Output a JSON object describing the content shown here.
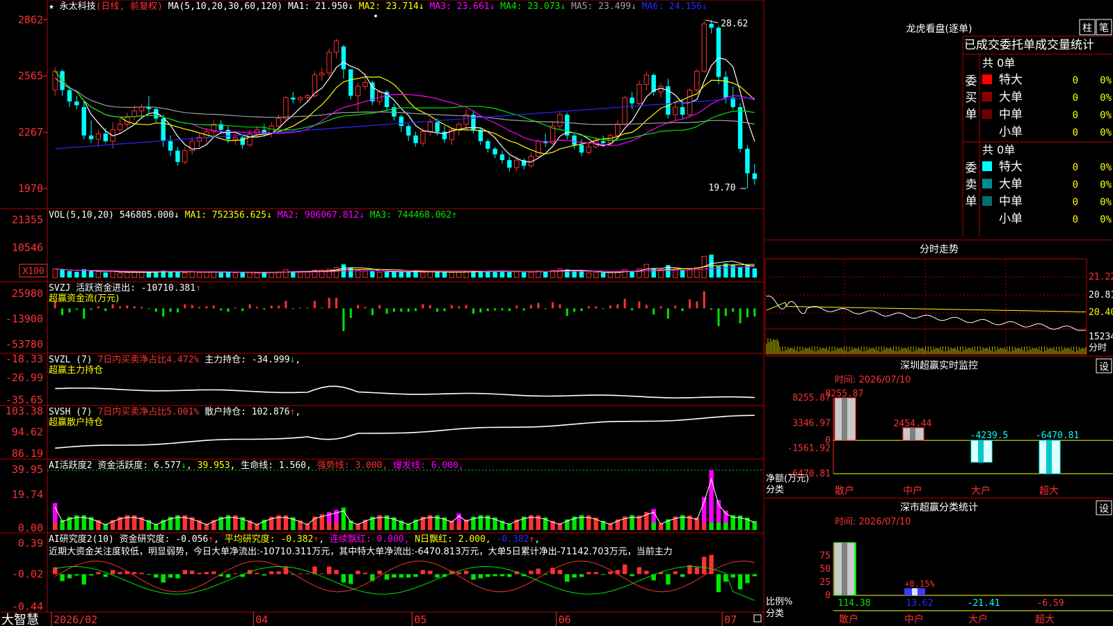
{
  "app": {
    "brand": "大智慧",
    "settings_label": "设",
    "buttons": {
      "zhu": "柱",
      "bi": "笔"
    }
  },
  "colors": {
    "red": "#ff3232",
    "cyan": "#00ffff",
    "white": "#ffffff",
    "yellow": "#ffff00",
    "magenta": "#ff00ff",
    "green": "#00e600",
    "blue": "#2828ff",
    "gray": "#a0a0a0",
    "frame": "#b40000"
  },
  "main_chart": {
    "star": "★",
    "stock_name": "永太科技",
    "period": "(日线, 前复权)",
    "ma_prefix": "MA(5,10,20,30,60,120)",
    "ma": [
      {
        "label": "MA1:",
        "value": "21.950",
        "arrow": "↓",
        "color": "#ffffff"
      },
      {
        "label": "MA2:",
        "value": "23.714",
        "arrow": "↓",
        "color": "#ffff00"
      },
      {
        "label": "MA3:",
        "value": "23.661",
        "arrow": "↓",
        "color": "#ff00ff"
      },
      {
        "label": "MA4:",
        "value": "23.073",
        "arrow": "↓",
        "color": "#00e600"
      },
      {
        "label": "MA5:",
        "value": "23.499",
        "arrow": "↓",
        "color": "#a0a0a0"
      },
      {
        "label": "MA6:",
        "value": "24.156",
        "arrow": "↓",
        "color": "#2828ff"
      }
    ],
    "y_ticks": [
      "2862",
      "2565",
      "2267",
      "1970"
    ],
    "y_values": [
      28.62,
      25.65,
      22.67,
      19.7
    ],
    "high_label": "28.62",
    "low_label": "19.70",
    "price_range": [
      19.0,
      29.0
    ]
  },
  "x_axis": {
    "labels": [
      "2026/02",
      "04",
      "05",
      "06",
      "07"
    ],
    "label_index": [
      0,
      28,
      50,
      70,
      93
    ]
  },
  "vol_panel": {
    "title": "VOL(5,10,20)",
    "vol": "546805.000",
    "vol_arrow": "↓",
    "ma1": "MA1: 752356.625",
    "ma1_arrow": "↓",
    "ma2": "MA2: 906067.812",
    "ma2_arrow": "↓",
    "ma3": "MA3: 744468.062",
    "ma3_arrow": "↑",
    "y_ticks": [
      "21355",
      "10546"
    ],
    "unit": "X100",
    "max": 22000
  },
  "svzj_panel": {
    "title": "SVZJ",
    "label": "活跃资金进出:",
    "value": "-10710.381",
    "arrow": "↑",
    "subtitle": "超赢资金流(万元)",
    "y_ticks": [
      "25980",
      "-13900",
      "-53780"
    ],
    "range": [
      -53780,
      25980
    ]
  },
  "svzl_panel": {
    "title": "SVZL (7)",
    "ratio_text": "7日内买卖净占比4.472%",
    "holding_label": "主力持仓:",
    "holding_value": "-34.999",
    "arrow": "↓",
    "subtitle": "超赢主力持仓",
    "y_ticks": [
      "-18.33",
      "-26.99",
      "-35.65"
    ],
    "range": [
      -35.65,
      -18.33
    ]
  },
  "svsh_panel": {
    "title": "SVSH (7)",
    "ratio_text": "7日内买卖净占比5.001%",
    "holding_label": "散户持仓:",
    "holding_value": "102.876",
    "arrow": "↑",
    "subtitle": "超赢散户持仓",
    "y_ticks": [
      "103.38",
      "94.62",
      "86.19"
    ],
    "range": [
      86.19,
      103.38
    ]
  },
  "ai_active_panel": {
    "title": "AI活跃度2",
    "label": "资金活跃度:",
    "value1": "6.577",
    "arrow1": "↓",
    "value2": "39.953",
    "life_label": "生命线:",
    "life_value": "1.560",
    "strong_label": "强势线:",
    "strong_value": "3.000",
    "burst_label": "爆发线:",
    "burst_value": "6.000",
    "y_ticks": [
      "39.95",
      "19.74",
      "0.00"
    ],
    "max": 39.95
  },
  "ai_research_panel": {
    "title": "AI研究度2(10)",
    "label": "资金研究度:",
    "value": "-0.056",
    "arrow": "↑",
    "avg_label": "平均研究度:",
    "avg_value": "-0.382",
    "avg_arrow": "↑",
    "red_label": "连续飘红:",
    "red_value": "0.000",
    "n_label": "N日飘红:",
    "n_value": "2.000",
    "last_value": "-0.382",
    "last_arrow": "↑",
    "comment": "近期大资金关注度较低，明显弱势，今日大单净流出:-10710.311万元，其中特大单净流出:-6470.813万元，大单5日累计净出-71142.703万元，当前主力",
    "y_ticks": [
      "0.39",
      "-0.02",
      "-0.44"
    ],
    "range": [
      -0.44,
      0.39
    ]
  },
  "right_top": {
    "title": "龙虎看盘(逐单)",
    "headers": [
      "已成交",
      "委托单",
      "成交量统计"
    ],
    "buy_section": {
      "side_label": [
        "委",
        "买",
        "单"
      ],
      "total": "共 0单",
      "rows": [
        {
          "name": "特大",
          "count": "0",
          "pct": "0%",
          "color": "#ff0000"
        },
        {
          "name": "大单",
          "count": "0",
          "pct": "0%",
          "color": "#8b0000"
        },
        {
          "name": "中单",
          "count": "0",
          "pct": "0%",
          "color": "#6e0000"
        },
        {
          "name": "小单",
          "count": "0",
          "pct": "0%",
          "color": ""
        }
      ]
    },
    "sell_section": {
      "side_label": [
        "委",
        "卖",
        "单"
      ],
      "total": "共 0单",
      "rows": [
        {
          "name": "特大",
          "count": "0",
          "pct": "0%",
          "color": "#00ffff"
        },
        {
          "name": "大单",
          "count": "0",
          "pct": "0%",
          "color": "#008b8b"
        },
        {
          "name": "中单",
          "count": "0",
          "pct": "0%",
          "color": "#006e6e"
        },
        {
          "name": "小单",
          "count": "0",
          "pct": "0%",
          "color": ""
        }
      ]
    }
  },
  "intraday": {
    "title": "分时走势",
    "y_ticks": [
      "21.22",
      "20.81",
      "20.40"
    ],
    "vol_label": "15234",
    "vol_sub": "分时"
  },
  "sz_monitor": {
    "title": "深圳超赢实时监控",
    "time_label": "时间: 2026/07/10",
    "y_ticks": [
      "8255.87",
      "3346.97",
      "0",
      "-1561.92",
      "-6470.81"
    ],
    "range": [
      -6470.81,
      8255.87
    ],
    "unit_label": "净额(万元)",
    "category_label": "分类",
    "bars": [
      {
        "name": "散户",
        "value": 8255.87,
        "label": "8255.87"
      },
      {
        "name": "中户",
        "value": 2454.44,
        "label": "2454.44"
      },
      {
        "name": "大户",
        "value": -4239.5,
        "label": "-4239.5"
      },
      {
        "name": "超大",
        "value": -6470.81,
        "label": "-6470.81"
      }
    ]
  },
  "sz_class": {
    "title": "深市超赢分类统计",
    "time_label": "时间: 2026/07/10",
    "y_ticks": [
      "75",
      "50",
      "25",
      "0"
    ],
    "ratio_label": "比例%",
    "category_label": "分类",
    "bars": [
      {
        "name": "散户",
        "value": 114.38,
        "label": "114.38"
      },
      {
        "name": "中户",
        "value": 13.62,
        "label": "13.62"
      },
      {
        "name": "大户",
        "value": -21.41,
        "label": "-21.41"
      },
      {
        "name": "超大",
        "value": -6.59,
        "label": "-6.59"
      }
    ],
    "mid_label": "+0.15%"
  },
  "chart_data": [
    {
      "type": "candlestick",
      "title": "永太科技 (日线, 前复权)",
      "ylim": [
        19.7,
        28.62
      ],
      "ohlc": [
        [
          24.9,
          26.1,
          24.6,
          25.9
        ],
        [
          25.9,
          26.0,
          24.6,
          24.9
        ],
        [
          24.9,
          25.1,
          24.0,
          24.3
        ],
        [
          24.3,
          24.6,
          23.9,
          24.1
        ],
        [
          24.0,
          24.3,
          22.3,
          22.5
        ],
        [
          22.5,
          23.3,
          22.1,
          22.3
        ],
        [
          22.3,
          22.8,
          21.9,
          22.6
        ],
        [
          22.6,
          22.9,
          22.1,
          22.2
        ],
        [
          22.2,
          23.2,
          21.8,
          22.8
        ],
        [
          22.8,
          23.4,
          22.6,
          23.1
        ],
        [
          23.1,
          23.7,
          22.9,
          23.5
        ],
        [
          23.5,
          24.1,
          23.3,
          23.8
        ],
        [
          23.8,
          24.2,
          23.4,
          24.0
        ],
        [
          24.0,
          24.6,
          23.7,
          23.9
        ],
        [
          23.9,
          24.0,
          23.2,
          23.4
        ],
        [
          23.4,
          23.6,
          21.9,
          22.2
        ],
        [
          22.2,
          22.5,
          21.4,
          21.7
        ],
        [
          21.7,
          21.9,
          20.9,
          21.1
        ],
        [
          21.1,
          21.9,
          21.0,
          21.7
        ],
        [
          21.7,
          22.4,
          21.5,
          22.2
        ],
        [
          22.2,
          22.6,
          21.9,
          22.4
        ],
        [
          22.4,
          22.9,
          22.1,
          22.7
        ],
        [
          22.7,
          23.3,
          22.5,
          23.1
        ],
        [
          23.1,
          23.3,
          22.6,
          22.8
        ],
        [
          22.8,
          23.0,
          22.1,
          22.3
        ],
        [
          22.3,
          22.6,
          22.0,
          22.4
        ],
        [
          22.4,
          22.5,
          21.8,
          22.0
        ],
        [
          22.0,
          22.8,
          21.9,
          22.6
        ],
        [
          22.6,
          23.0,
          22.4,
          22.8
        ],
        [
          22.8,
          23.1,
          22.5,
          22.6
        ],
        [
          22.6,
          23.2,
          22.4,
          23.0
        ],
        [
          23.0,
          23.6,
          22.9,
          23.4
        ],
        [
          23.4,
          24.6,
          23.3,
          24.5
        ],
        [
          24.5,
          24.8,
          24.2,
          24.4
        ],
        [
          24.4,
          24.6,
          24.2,
          24.5
        ],
        [
          24.5,
          24.7,
          24.3,
          24.6
        ],
        [
          24.6,
          25.9,
          24.5,
          25.7
        ],
        [
          25.7,
          26.1,
          25.4,
          25.8
        ],
        [
          25.8,
          27.1,
          25.6,
          26.9
        ],
        [
          26.9,
          27.6,
          26.6,
          27.5
        ],
        [
          27.2,
          27.3,
          25.5,
          26.0
        ],
        [
          26.0,
          25.9,
          24.4,
          24.6
        ],
        [
          24.6,
          25.3,
          23.8,
          25.1
        ],
        [
          25.1,
          25.6,
          24.9,
          25.3
        ],
        [
          25.3,
          25.4,
          24.1,
          24.3
        ],
        [
          24.3,
          24.9,
          24.1,
          24.8
        ],
        [
          24.8,
          24.9,
          23.8,
          24.0
        ],
        [
          24.0,
          24.2,
          23.3,
          23.5
        ],
        [
          23.5,
          23.6,
          22.7,
          23.0
        ],
        [
          23.0,
          23.1,
          22.2,
          22.5
        ],
        [
          22.5,
          22.7,
          21.9,
          22.1
        ],
        [
          22.1,
          22.9,
          21.9,
          22.7
        ],
        [
          22.7,
          23.4,
          22.5,
          23.2
        ],
        [
          23.2,
          23.4,
          22.5,
          22.7
        ],
        [
          22.7,
          23.0,
          22.1,
          22.3
        ],
        [
          22.3,
          22.9,
          22.0,
          22.8
        ],
        [
          22.8,
          23.2,
          22.5,
          23.1
        ],
        [
          23.1,
          23.9,
          22.8,
          23.6
        ],
        [
          23.6,
          23.8,
          22.6,
          22.8
        ],
        [
          22.8,
          22.9,
          22.0,
          22.2
        ],
        [
          22.2,
          22.3,
          21.6,
          21.8
        ],
        [
          21.8,
          21.9,
          21.3,
          21.5
        ],
        [
          21.5,
          21.7,
          21.0,
          21.2
        ],
        [
          21.2,
          21.4,
          20.6,
          20.8
        ],
        [
          20.8,
          21.4,
          20.6,
          21.2
        ],
        [
          21.2,
          21.3,
          20.7,
          20.9
        ],
        [
          20.9,
          21.6,
          20.8,
          21.4
        ],
        [
          21.4,
          22.3,
          21.3,
          22.2
        ],
        [
          22.2,
          22.6,
          21.9,
          22.1
        ],
        [
          22.1,
          23.2,
          22.0,
          23.0
        ],
        [
          23.0,
          23.8,
          22.8,
          23.6
        ],
        [
          23.6,
          23.7,
          22.3,
          22.5
        ],
        [
          22.5,
          22.6,
          21.8,
          22.0
        ],
        [
          22.0,
          22.3,
          21.4,
          21.6
        ],
        [
          21.6,
          22.1,
          21.5,
          21.9
        ],
        [
          21.9,
          22.4,
          21.8,
          22.2
        ],
        [
          22.2,
          22.5,
          21.9,
          22.1
        ],
        [
          22.1,
          22.6,
          22.0,
          22.5
        ],
        [
          22.5,
          23.3,
          22.4,
          23.1
        ],
        [
          23.1,
          24.6,
          23.0,
          24.5
        ],
        [
          24.5,
          24.8,
          23.9,
          24.2
        ],
        [
          24.2,
          25.4,
          24.1,
          25.2
        ],
        [
          25.2,
          25.9,
          24.9,
          25.7
        ],
        [
          25.7,
          25.8,
          24.6,
          24.8
        ],
        [
          24.8,
          25.3,
          24.5,
          25.1
        ],
        [
          25.1,
          25.5,
          23.4,
          23.6
        ],
        [
          23.6,
          24.2,
          23.3,
          24.0
        ],
        [
          24.0,
          24.4,
          23.4,
          23.6
        ],
        [
          23.6,
          25.0,
          23.5,
          24.9
        ],
        [
          24.9,
          26.0,
          24.8,
          25.9
        ],
        [
          25.9,
          28.6,
          25.8,
          28.4
        ],
        [
          28.4,
          28.6,
          27.9,
          28.2
        ],
        [
          28.2,
          28.3,
          25.2,
          25.6
        ],
        [
          25.6,
          25.9,
          24.2,
          24.5
        ],
        [
          24.5,
          25.1,
          23.9,
          24.0
        ],
        [
          24.0,
          24.2,
          21.6,
          21.8
        ],
        [
          21.8,
          22.0,
          19.7,
          20.5
        ],
        [
          20.5,
          21.0,
          19.9,
          20.2
        ]
      ],
      "vol": [
        3200,
        2900,
        2400,
        2100,
        3100,
        2400,
        2200,
        1900,
        2300,
        1700,
        1900,
        2000,
        1900,
        2000,
        2200,
        2600,
        2400,
        2300,
        1800,
        2100,
        1900,
        2000,
        2200,
        1800,
        2100,
        1700,
        2000,
        1900,
        1700,
        1800,
        1900,
        2100,
        2900,
        2300,
        2000,
        2000,
        2700,
        2800,
        3100,
        3800,
        4900,
        3600,
        2800,
        2400,
        2300,
        2000,
        2100,
        2200,
        2100,
        2300,
        2200,
        2000,
        2100,
        2000,
        2100,
        1900,
        2000,
        2200,
        2600,
        2300,
        2500,
        2200,
        2300,
        2400,
        2100,
        2000,
        2000,
        2400,
        2200,
        2600,
        3200,
        3000,
        2400,
        2300,
        1700,
        1900,
        1800,
        1800,
        2100,
        3000,
        2500,
        3300,
        4900,
        3200,
        2900,
        4600,
        2900,
        2900,
        3100,
        3700,
        7900,
        8500,
        4200,
        5200,
        4600,
        4000,
        4600,
        3400
      ]
    }
  ]
}
